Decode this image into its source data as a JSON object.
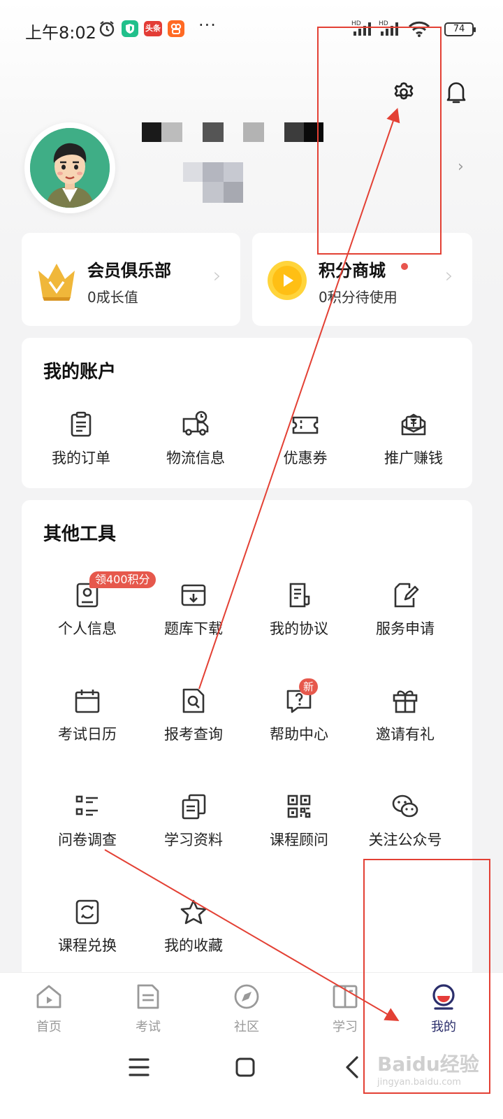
{
  "status_bar": {
    "time": "上午8:02",
    "app_badge_text": "头条",
    "more": "···",
    "net_label_1": "HD",
    "net_label_2": "HD",
    "battery": "74"
  },
  "header": {
    "settings_icon": "gear-icon",
    "notification_icon": "bell-icon"
  },
  "profile": {
    "chevron": "›"
  },
  "member_cards": [
    {
      "title": "会员俱乐部",
      "subtitle": "0成长值",
      "icon": "crown-icon",
      "chevron": "›"
    },
    {
      "title": "积分商城",
      "subtitle": "0积分待使用",
      "icon": "points-coin-icon",
      "chevron": "›"
    }
  ],
  "account": {
    "title": "我的账户",
    "items": [
      {
        "label": "我的订单",
        "icon": "clipboard-icon"
      },
      {
        "label": "物流信息",
        "icon": "truck-icon"
      },
      {
        "label": "优惠券",
        "icon": "coupon-icon"
      },
      {
        "label": "推广赚钱",
        "icon": "wallet-yen-icon"
      }
    ]
  },
  "tools": {
    "title": "其他工具",
    "items": [
      {
        "label": "个人信息",
        "icon": "id-card-icon",
        "tag": "领400积分"
      },
      {
        "label": "题库下载",
        "icon": "download-box-icon",
        "tag": ""
      },
      {
        "label": "我的协议",
        "icon": "document-icon",
        "tag": ""
      },
      {
        "label": "服务申请",
        "icon": "edit-icon",
        "tag": ""
      },
      {
        "label": "考试日历",
        "icon": "calendar-icon",
        "tag": ""
      },
      {
        "label": "报考查询",
        "icon": "search-doc-icon",
        "tag": ""
      },
      {
        "label": "帮助中心",
        "icon": "help-chat-icon",
        "tag": "新"
      },
      {
        "label": "邀请有礼",
        "icon": "gift-icon",
        "tag": ""
      },
      {
        "label": "问卷调查",
        "icon": "list-icon",
        "tag": ""
      },
      {
        "label": "学习资料",
        "icon": "copy-docs-icon",
        "tag": ""
      },
      {
        "label": "课程顾问",
        "icon": "qr-code-icon",
        "tag": ""
      },
      {
        "label": "关注公众号",
        "icon": "wechat-icon",
        "tag": ""
      },
      {
        "label": "课程兑换",
        "icon": "exchange-icon",
        "tag": ""
      },
      {
        "label": "我的收藏",
        "icon": "star-icon",
        "tag": ""
      }
    ]
  },
  "bottom_nav": {
    "items": [
      {
        "label": "首页",
        "icon": "home-icon"
      },
      {
        "label": "考试",
        "icon": "exam-icon"
      },
      {
        "label": "社区",
        "icon": "compass-icon"
      },
      {
        "label": "学习",
        "icon": "book-icon"
      },
      {
        "label": "我的",
        "icon": "profile-icon",
        "active": true
      }
    ]
  },
  "system_nav": {
    "items": [
      "menu-icon",
      "home-square-icon",
      "back-icon"
    ]
  },
  "watermark": {
    "logo": "Baidu经验",
    "url": "jingyan.baidu.com"
  },
  "colors": {
    "accent_red": "#e6584c",
    "annotation_red": "#e34034",
    "active_nav": "#2b2e6b",
    "crown_gold": "#e3a526",
    "coin_yellow": "#ffc814"
  }
}
